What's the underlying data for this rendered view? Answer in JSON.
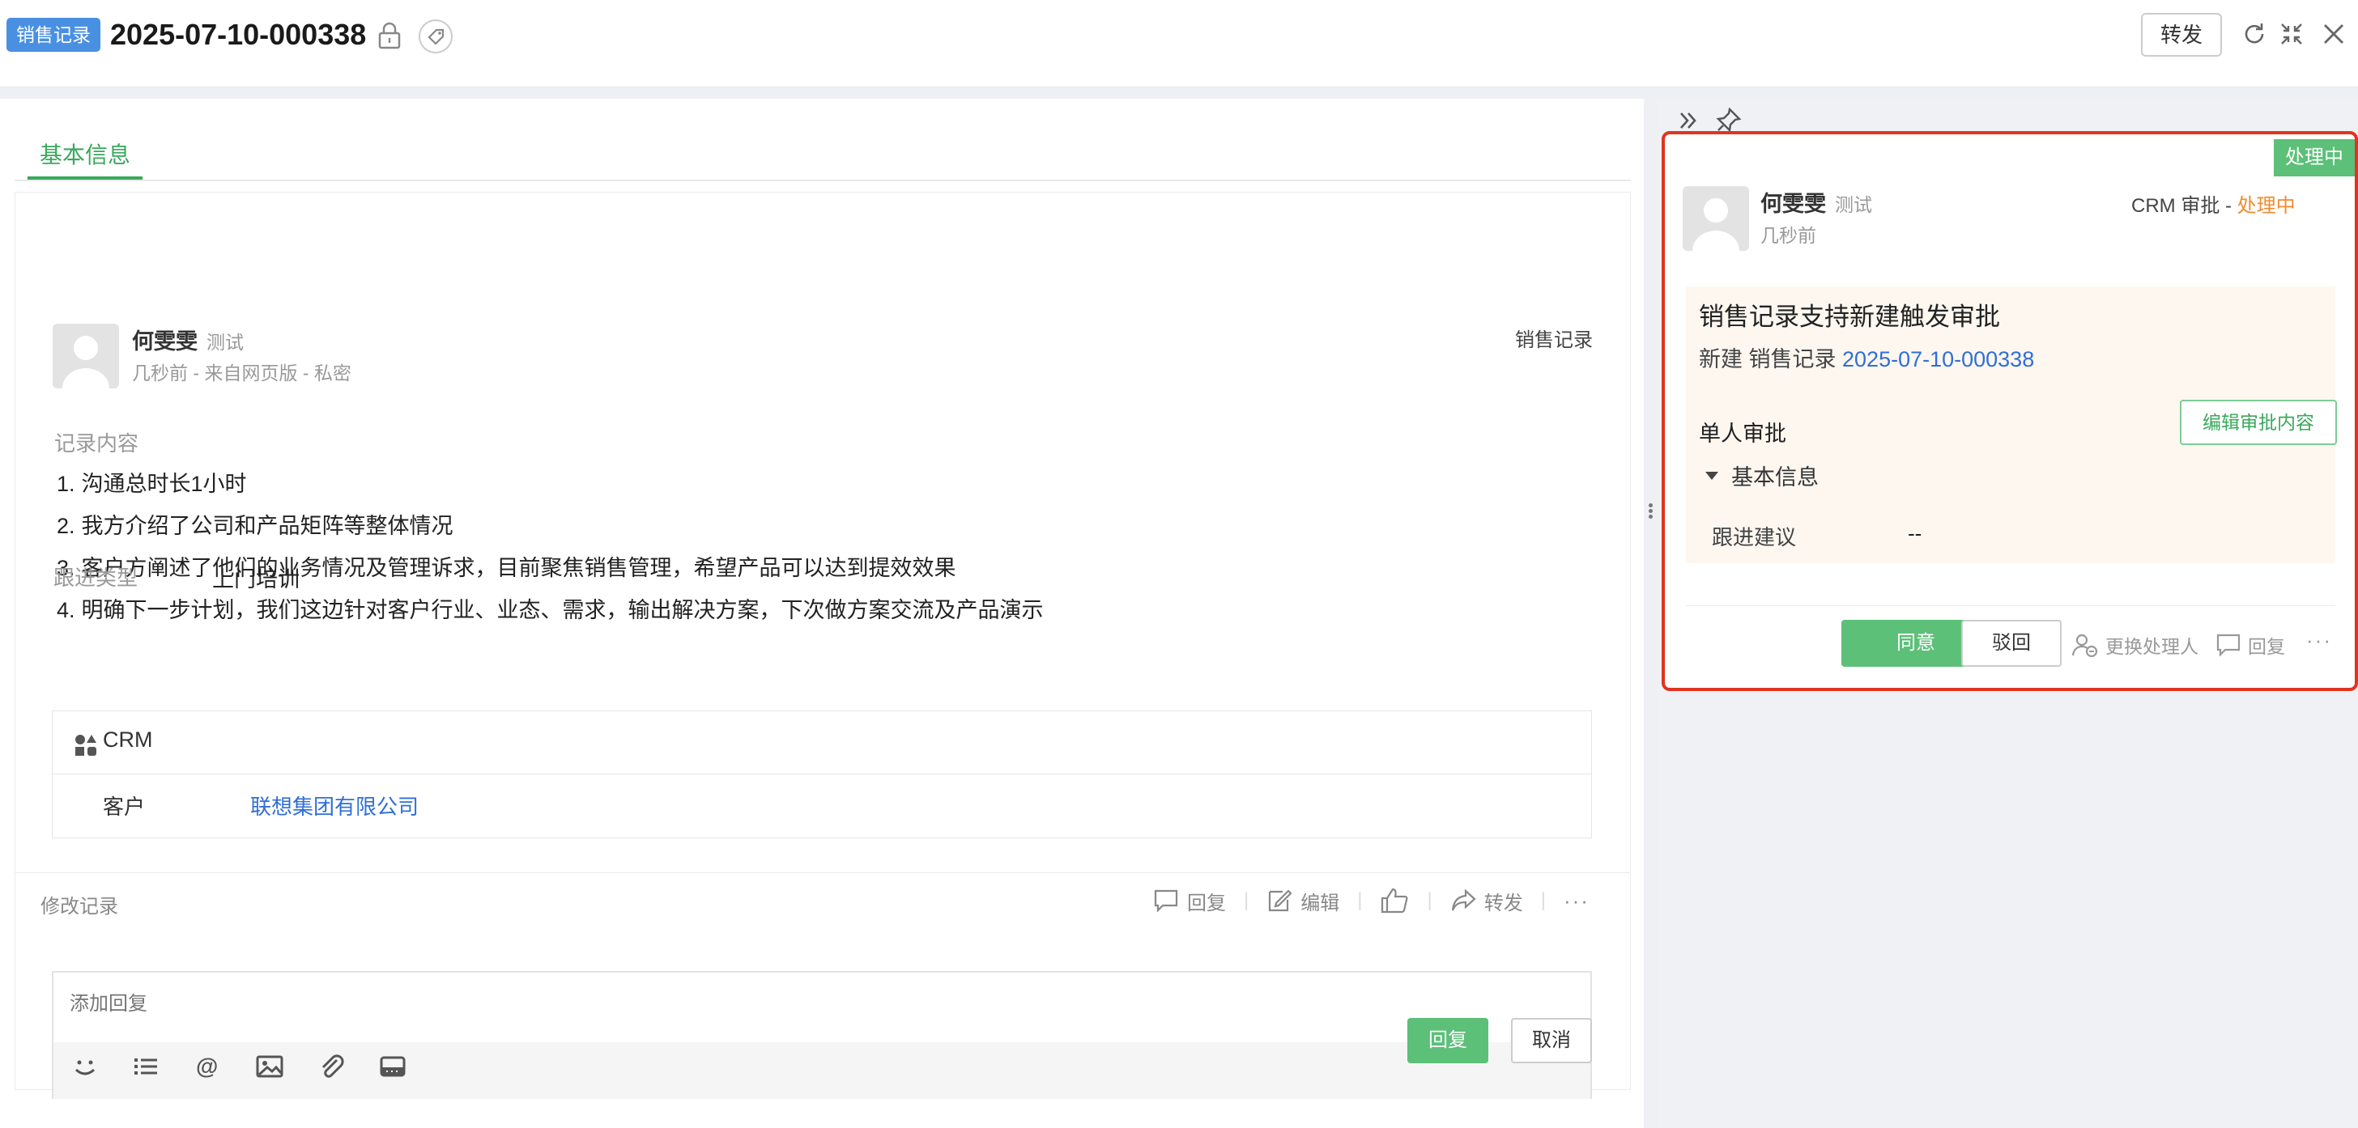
{
  "header": {
    "type_badge": "销售记录",
    "title": "2025-07-10-000338",
    "forward_label": "转发"
  },
  "tabs": [
    "基本信息"
  ],
  "post": {
    "author_name": "何雯雯",
    "author_dept": "测试",
    "meta": "几秒前 - 来自网页版 - 私密",
    "category": "销售记录",
    "content_label": "记录内容",
    "content_items": [
      "沟通总时长1小时",
      "我方介绍了公司和产品矩阵等整体情况",
      "客户方阐述了他们的业务情况及管理诉求，目前聚焦销售管理，希望产品可以达到提效效果",
      "明确下一步计划，我们这边针对客户行业、业态、需求，输出解决方案，下次做方案交流及产品演示"
    ],
    "item_numbers": [
      "1.",
      "2.",
      "3.",
      "4."
    ],
    "follow_type_label": "跟进类型",
    "follow_type_value": "上门培训",
    "crm_label": "CRM",
    "customer_label": "客户",
    "customer_value": "联想集团有限公司",
    "history_link": "修改记录",
    "actions": {
      "reply": "回复",
      "edit": "编辑",
      "forward": "转发",
      "more": "···"
    }
  },
  "reply_box": {
    "placeholder": "添加回复",
    "submit": "回复",
    "cancel": "取消"
  },
  "approval": {
    "status_badge": "处理中",
    "applicant_name": "何雯雯",
    "applicant_dept": "测试",
    "time": "几秒前",
    "flow_prefix": "CRM 审批 - ",
    "flow_status": "处理中",
    "title": "销售记录支持新建触发审批",
    "subtitle_prefix": "新建 销售记录 ",
    "subtitle_link": "2025-07-10-000338",
    "mode": "单人审批",
    "edit_button": "编辑审批内容",
    "section": "基本信息",
    "field_label": "跟进建议",
    "field_value": "--",
    "agree": "同意",
    "reject": "驳回",
    "change_handler": "更换处理人",
    "reply": "回复",
    "more": "···"
  },
  "colors": {
    "accent_green": "#5cc078",
    "link_blue": "#2f6fd6",
    "status_orange": "#f08c2e",
    "highlight_red": "#e0341f",
    "badge_blue": "#4a90e2"
  }
}
